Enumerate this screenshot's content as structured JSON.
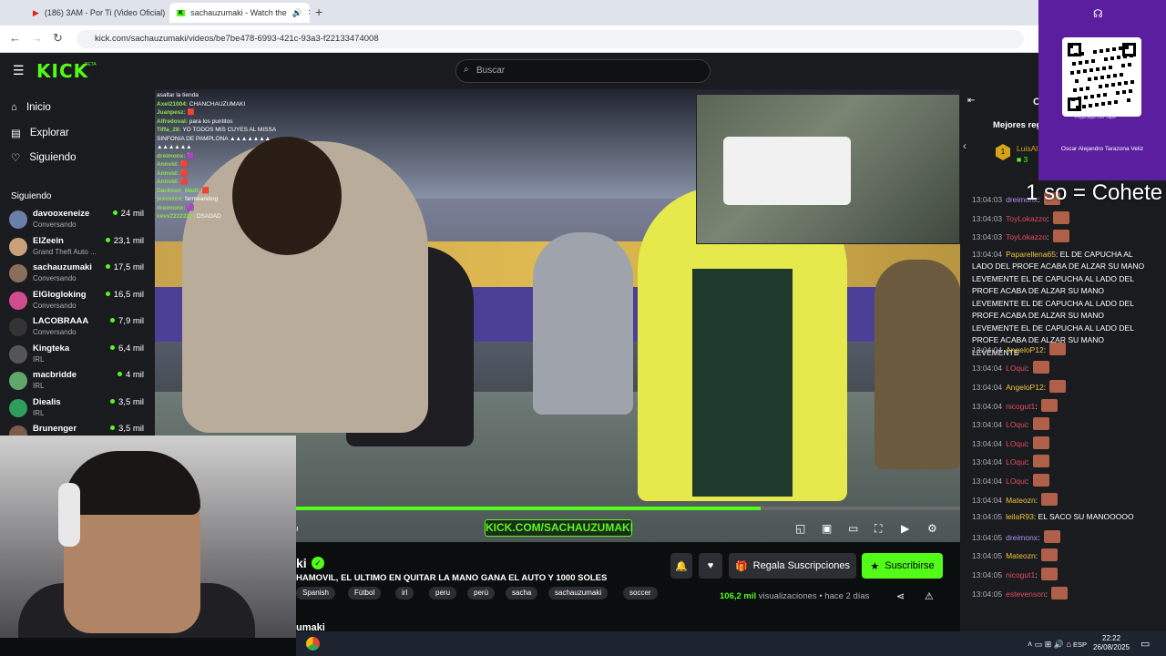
{
  "browser": {
    "tabs": [
      {
        "label": "(186) 3AM - Por Ti (Video Oficial)",
        "icon": "youtube-icon"
      },
      {
        "label": "sachauzumaki - Watch the",
        "icon": "kick-icon"
      }
    ],
    "url": "kick.com/sachauzumaki/videos/be7be478-6993-421c-93a3-f22133474008"
  },
  "header": {
    "logo": "KICK",
    "beta": "BETA",
    "search_placeholder": "Buscar"
  },
  "nav": [
    {
      "label": "Inicio",
      "icon": "home-icon"
    },
    {
      "label": "Explorar",
      "icon": "browse-icon"
    },
    {
      "label": "Siguiendo",
      "icon": "heart-icon"
    }
  ],
  "following": {
    "heading": "Siguiendo",
    "channels": [
      {
        "name": "davooxeneize",
        "category": "Conversando",
        "viewers": "24 mil",
        "color": "#6a7fa8"
      },
      {
        "name": "ElZeein",
        "category": "Grand Theft Auto ...",
        "viewers": "23,1 mil",
        "color": "#c9a27a"
      },
      {
        "name": "sachauzumaki",
        "category": "Conversando",
        "viewers": "17,5 mil",
        "color": "#8a6e5c"
      },
      {
        "name": "ElGlogloking",
        "category": "Conversando",
        "viewers": "16,5 mil",
        "color": "#d24b8f"
      },
      {
        "name": "LACOBRAAA",
        "category": "Conversando",
        "viewers": "7,9 mil",
        "color": "#333333"
      },
      {
        "name": "Kingteka",
        "category": "IRL",
        "viewers": "6,4 mil",
        "color": "#555555"
      },
      {
        "name": "macbridde",
        "category": "IRL",
        "viewers": "4 mil",
        "color": "#5fa86a"
      },
      {
        "name": "Diealis",
        "category": "IRL",
        "viewers": "3,5 mil",
        "color": "#2e9e5b"
      },
      {
        "name": "Brunenger",
        "category": "",
        "viewers": "3,5 mil",
        "color": "#7d5a4a"
      }
    ]
  },
  "video_chat_overlay": [
    {
      "user": "",
      "text": "asaltar la tienda"
    },
    {
      "user": "Axel21004:",
      "text": "CHANCHAUZUMAKI"
    },
    {
      "user": "Juanpesz:",
      "text": "🟥"
    },
    {
      "user": "Alfredoval:",
      "text": "para los puntitos"
    },
    {
      "user": "Tiffa_28:",
      "text": "YO TODOS MIS CUYES AL MISSA"
    },
    {
      "user": "",
      "text": "SINFONIA DE PAMPLONA ▲▲▲▲▲▲▲"
    },
    {
      "user": "",
      "text": "▲▲▲▲▲▲"
    },
    {
      "user": "dreimonx:",
      "text": "🟪"
    },
    {
      "user": "Annvid:",
      "text": "🟥"
    },
    {
      "user": "Annvid:",
      "text": "🟥"
    },
    {
      "user": "Annvid:",
      "text": "🟥"
    },
    {
      "user": "Dackson_Madi:",
      "text": "🟥"
    },
    {
      "user": "jesuszca:",
      "text": "farmeanding"
    },
    {
      "user": "dreimonx:",
      "text": "🟪"
    },
    {
      "user": "kevv2222222:",
      "text": "DSADAD"
    }
  ],
  "player": {
    "watermark": "KICK.COM/SACHAUZUMAKI",
    "progress": 0.7,
    "controls": [
      "pip-icon",
      "theater-icon",
      "miniplayer-icon",
      "fullscreen-icon",
      "clip-icon",
      "settings-icon"
    ],
    "left_label": "ı"
  },
  "stream": {
    "channel": "ki",
    "title": "HAMOVIL, EL ULTIMO EN QUITAR LA MANO GANA EL AUTO Y 1000 SOLES",
    "tags": [
      "Spanish",
      "Fútbol",
      "irl",
      "peru",
      "perú",
      "sacha",
      "sachauzumaki",
      "soccer"
    ],
    "views_count": "106,2 mil",
    "views_label": "visualizaciones",
    "dot": "•",
    "ago": "hace 2 días",
    "gift_label": "Regala Suscripciones",
    "subscribe_label": "Suscribirse",
    "username_partial": "umaki"
  },
  "chat": {
    "header_initial": "C",
    "leaderboard_title": "Mejores reg",
    "top_user": "LuisAl",
    "top_rank": "1",
    "top_count": "3",
    "messages": [
      {
        "time": "13:04:03",
        "user": "dreimonx",
        "color": "#b58cf5",
        "text": "",
        "emote": true
      },
      {
        "time": "13:04:03",
        "user": "ToyLokazzo",
        "color": "#e84a5f",
        "text": "",
        "emote": true
      },
      {
        "time": "13:04:03",
        "user": "ToyLokazzo",
        "color": "#e84a5f",
        "text": "",
        "emote": true
      },
      {
        "time": "13:04:04",
        "user": "Paparellena65",
        "color": "#f2c23a",
        "text": "EL DE CAPUCHA AL LADO DEL PROFE ACABA DE ALZAR SU MANO LEVEMENTE EL DE CAPUCHA AL LADO DEL PROFE ACABA DE ALZAR SU MANO LEVEMENTE EL DE CAPUCHA AL LADO DEL PROFE ACABA DE ALZAR SU MANO LEVEMENTE EL DE CAPUCHA AL LADO DEL PROFE ACABA DE ALZAR SU MANO LEVEMENTE",
        "emote": false
      },
      {
        "time": "13:04:04",
        "user": "AngeloP12",
        "color": "#f2c23a",
        "text": "",
        "emote": true
      },
      {
        "time": "13:04:04",
        "user": "LOqui",
        "color": "#e84a5f",
        "text": "",
        "emote": true
      },
      {
        "time": "13:04:04",
        "user": "AngeloP12",
        "color": "#f2c23a",
        "text": "",
        "emote": true
      },
      {
        "time": "13:04:04",
        "user": "nicogut1",
        "color": "#e84a5f",
        "text": "",
        "emote": true
      },
      {
        "time": "13:04:04",
        "user": "LOqui",
        "color": "#e84a5f",
        "text": "",
        "emote": true
      },
      {
        "time": "13:04:04",
        "user": "LOqui",
        "color": "#e84a5f",
        "text": "",
        "emote": true
      },
      {
        "time": "13:04:04",
        "user": "LOqui",
        "color": "#e84a5f",
        "text": "",
        "emote": true
      },
      {
        "time": "13:04:04",
        "user": "LOqui",
        "color": "#e84a5f",
        "text": "",
        "emote": true
      },
      {
        "time": "13:04:04",
        "user": "Mateozn",
        "color": "#f2c23a",
        "text": "",
        "emote": true
      },
      {
        "time": "13:04:05",
        "user": "leilaR93",
        "color": "#f2c23a",
        "text": "EL SACO SU MANOOOOO",
        "emote": false
      },
      {
        "time": "13:04:05",
        "user": "dreimonx",
        "color": "#b58cf5",
        "text": "",
        "emote": true
      },
      {
        "time": "13:04:05",
        "user": "Mateozn",
        "color": "#f2c23a",
        "text": "",
        "emote": true
      },
      {
        "time": "13:04:05",
        "user": "nicogut1",
        "color": "#e84a5f",
        "text": "",
        "emote": true
      },
      {
        "time": "13:04:05",
        "user": "estevenson",
        "color": "#e84a5f",
        "text": "",
        "emote": true
      }
    ]
  },
  "overlay": {
    "qr_caption": "Pega aquí con Yape",
    "qr_name": "Oscar Alejandro Tarazona Veliz",
    "cohete_text": "1 so = Cohete",
    "logo": "yape"
  },
  "taskbar": {
    "lang": "ESP",
    "time": "22:22",
    "date": "26/08/2025"
  }
}
